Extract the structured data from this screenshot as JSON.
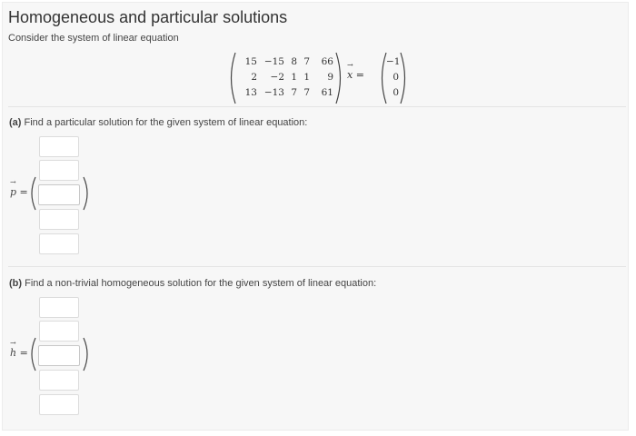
{
  "page": {
    "title": "Homogeneous and particular solutions",
    "intro": "Consider the system of linear equation"
  },
  "equation": {
    "matrix": [
      [
        "15",
        "−15",
        "8",
        "7",
        "66"
      ],
      [
        "2",
        "−2",
        "1",
        "1",
        "9"
      ],
      [
        "13",
        "−13",
        "7",
        "7",
        "61"
      ]
    ],
    "variable": "x",
    "equals": "=",
    "rhs": [
      "−1",
      "0",
      "0"
    ]
  },
  "part_a": {
    "label_prefix": "(a)",
    "label_text": " Find a particular solution for the given system of linear equation:",
    "variable": "p",
    "equals": "=",
    "inputs": [
      "",
      "",
      "",
      "",
      ""
    ]
  },
  "part_b": {
    "label_prefix": "(b)",
    "label_text": " Find a non-trivial homogeneous solution for the given system of linear equation:",
    "variable": "h",
    "equals": "=",
    "inputs": [
      "",
      "",
      "",
      "",
      ""
    ]
  }
}
